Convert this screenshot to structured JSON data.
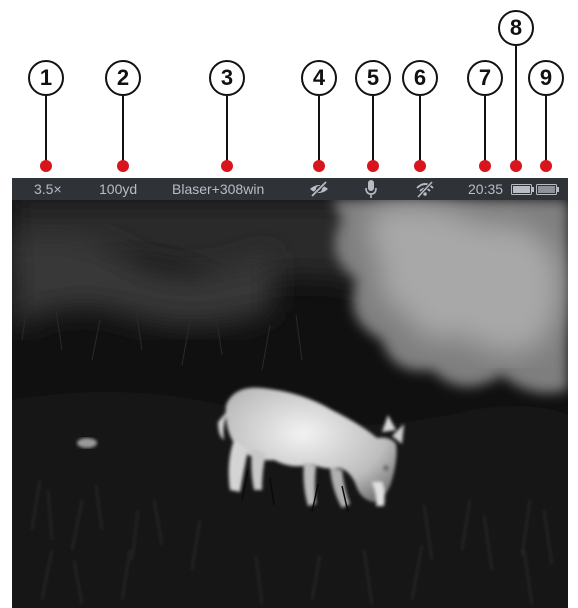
{
  "callouts": [
    "1",
    "2",
    "3",
    "4",
    "5",
    "6",
    "7",
    "8",
    "9"
  ],
  "status_bar": {
    "zoom": "3.5×",
    "distance": "100yd",
    "profile": "Blaser+308win",
    "icons": [
      "eye-off-icon",
      "microphone-icon",
      "wifi-off-icon",
      "battery-icon",
      "external-battery-icon"
    ],
    "time": "20:35"
  },
  "colors": {
    "callout_dot": "#d8141c",
    "status_bar_bg": "#2f3236",
    "status_text": "#b9bcc2"
  }
}
